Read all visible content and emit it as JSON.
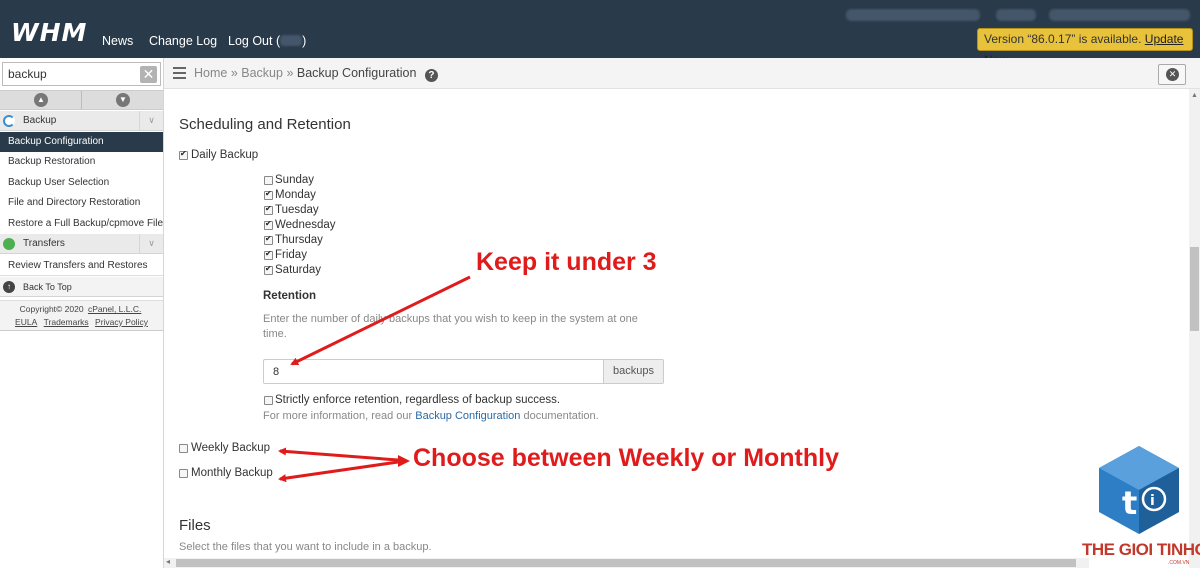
{
  "header": {
    "logo": "WHM",
    "nav": [
      "News",
      "Change Log",
      "Log Out ("
    ],
    "nav_logout_suffix": ")",
    "update_text": "Version “86.0.17” is available.",
    "update_link": "Update Now"
  },
  "sidebar": {
    "search_value": "backup",
    "categories": {
      "backup": "Backup",
      "transfers": "Transfers"
    },
    "items": [
      "Backup Configuration",
      "Backup Restoration",
      "Backup User Selection",
      "File and Directory Restoration",
      "Restore a Full Backup/cpmove File"
    ],
    "transfer_items": [
      "Review Transfers and Restores"
    ],
    "back_to_top": "Back To Top",
    "copyright": "Copyright© 2020",
    "copyright_link": "cPanel, L.L.C.",
    "footer_links": [
      "EULA",
      "Trademarks",
      "Privacy Policy"
    ]
  },
  "breadcrumb": {
    "home": "Home",
    "sep": "»",
    "backup": "Backup",
    "current": "Backup Configuration"
  },
  "main": {
    "scheduling_title": "Scheduling and Retention",
    "daily_label": "Daily Backup",
    "days": [
      {
        "label": "Sunday",
        "checked": false
      },
      {
        "label": "Monday",
        "checked": true
      },
      {
        "label": "Tuesday",
        "checked": true
      },
      {
        "label": "Wednesday",
        "checked": true
      },
      {
        "label": "Thursday",
        "checked": true
      },
      {
        "label": "Friday",
        "checked": true
      },
      {
        "label": "Saturday",
        "checked": true
      }
    ],
    "retention_title": "Retention",
    "retention_help_line1": "Enter the number of daily backups that you wish to keep in the system at one",
    "retention_help_line2": "time.",
    "retention_value": "8",
    "retention_unit": "backups",
    "strict_label": "Strictly enforce retention, regardless of backup success.",
    "more_info_prefix": "For more information, read our",
    "more_info_link": "Backup Configuration",
    "more_info_suffix": "documentation.",
    "weekly_label": "Weekly Backup",
    "monthly_label": "Monthly Backup",
    "files_title": "Files",
    "files_help": "Select the files that you want to include in a backup."
  },
  "annotations": {
    "keep_under": "Keep it under 3",
    "choose_between": "Choose between Weekly or Monthly",
    "color": "#e01b1b"
  },
  "watermark": {
    "text": "THE GIOI TINHOC",
    "sub": ".COM.VN"
  },
  "colors": {
    "topbar": "#293a4a",
    "active_item": "#293a4a",
    "update_banner": "#e8c23a",
    "link": "#2a6aa8"
  }
}
